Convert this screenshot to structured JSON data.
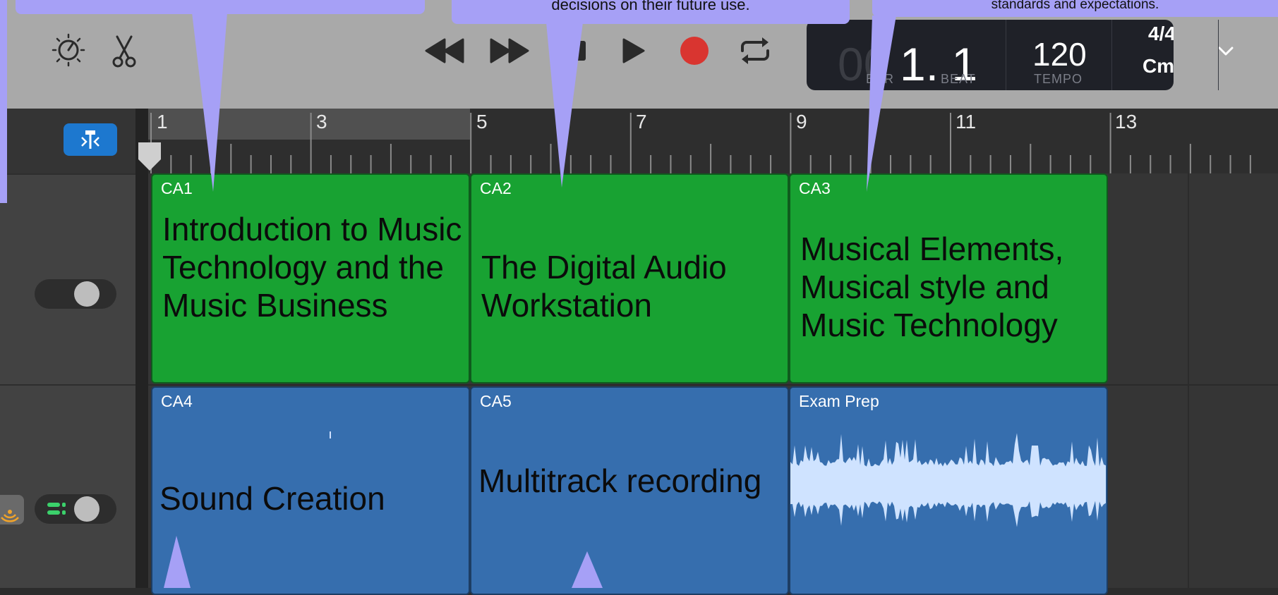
{
  "callouts": {
    "middle_text": "decisions on their future use.",
    "right_text": "standards and expectations."
  },
  "toolbar": {
    "icons": [
      "metronome-gauge-icon",
      "scissors-icon"
    ],
    "transport": [
      "rewind-icon",
      "fast-forward-icon",
      "stop-icon",
      "play-icon",
      "record-icon",
      "cycle-icon"
    ]
  },
  "lcd": {
    "bar_value": "00",
    "beat_value": "1. 1",
    "bar_label": "BAR",
    "beat_label": "BEAT",
    "tempo_value": "120",
    "tempo_label": "TEMPO",
    "time_signature": "4/4",
    "key": "Cmaj"
  },
  "ruler": {
    "bar_numbers": [
      "1",
      "3",
      "5",
      "7",
      "9",
      "11",
      "13"
    ]
  },
  "regions": [
    {
      "name": "CA1",
      "title": "Introduction to Music Technology and the Music Business",
      "color": "#18a232"
    },
    {
      "name": "CA2",
      "title": "The Digital Audio Workstation",
      "color": "#18a232"
    },
    {
      "name": "CA3",
      "title": "Musical Elements, Musical style and Music Technology",
      "color": "#18a232"
    },
    {
      "name": "CA4",
      "title": "Sound Creation",
      "color": "#366eae"
    },
    {
      "name": "CA5",
      "title": "Multitrack recording",
      "color": "#366eae"
    },
    {
      "name": "Exam Prep",
      "title": "",
      "color": "#366eae"
    }
  ],
  "colors": {
    "callout": "#a6a0f6",
    "record": "#d93530",
    "accent_blue": "#1d78cf",
    "toggle_green": "#3bd16b"
  }
}
